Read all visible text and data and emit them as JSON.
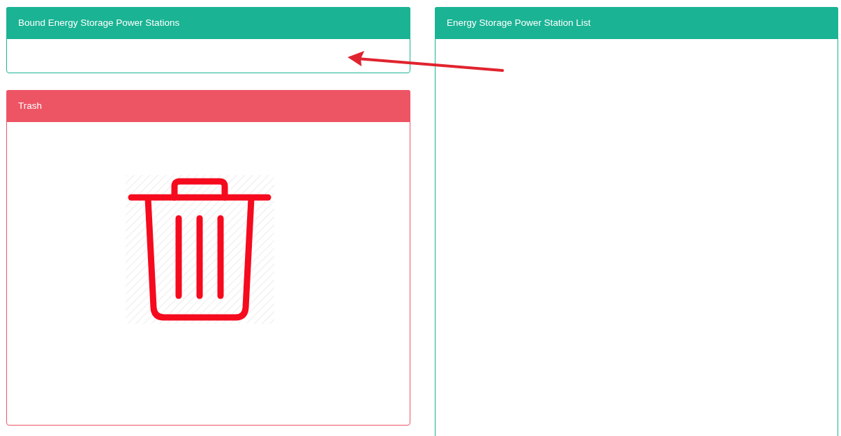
{
  "left_panels": [
    {
      "kind": "bound",
      "title": "Bound Energy Storage Power Stations",
      "color": "#1ab394"
    },
    {
      "kind": "trash",
      "title": "Trash",
      "color": "#ed5565"
    }
  ],
  "right_panel": {
    "title": "Energy Storage Power Station List",
    "color": "#1ab394"
  }
}
